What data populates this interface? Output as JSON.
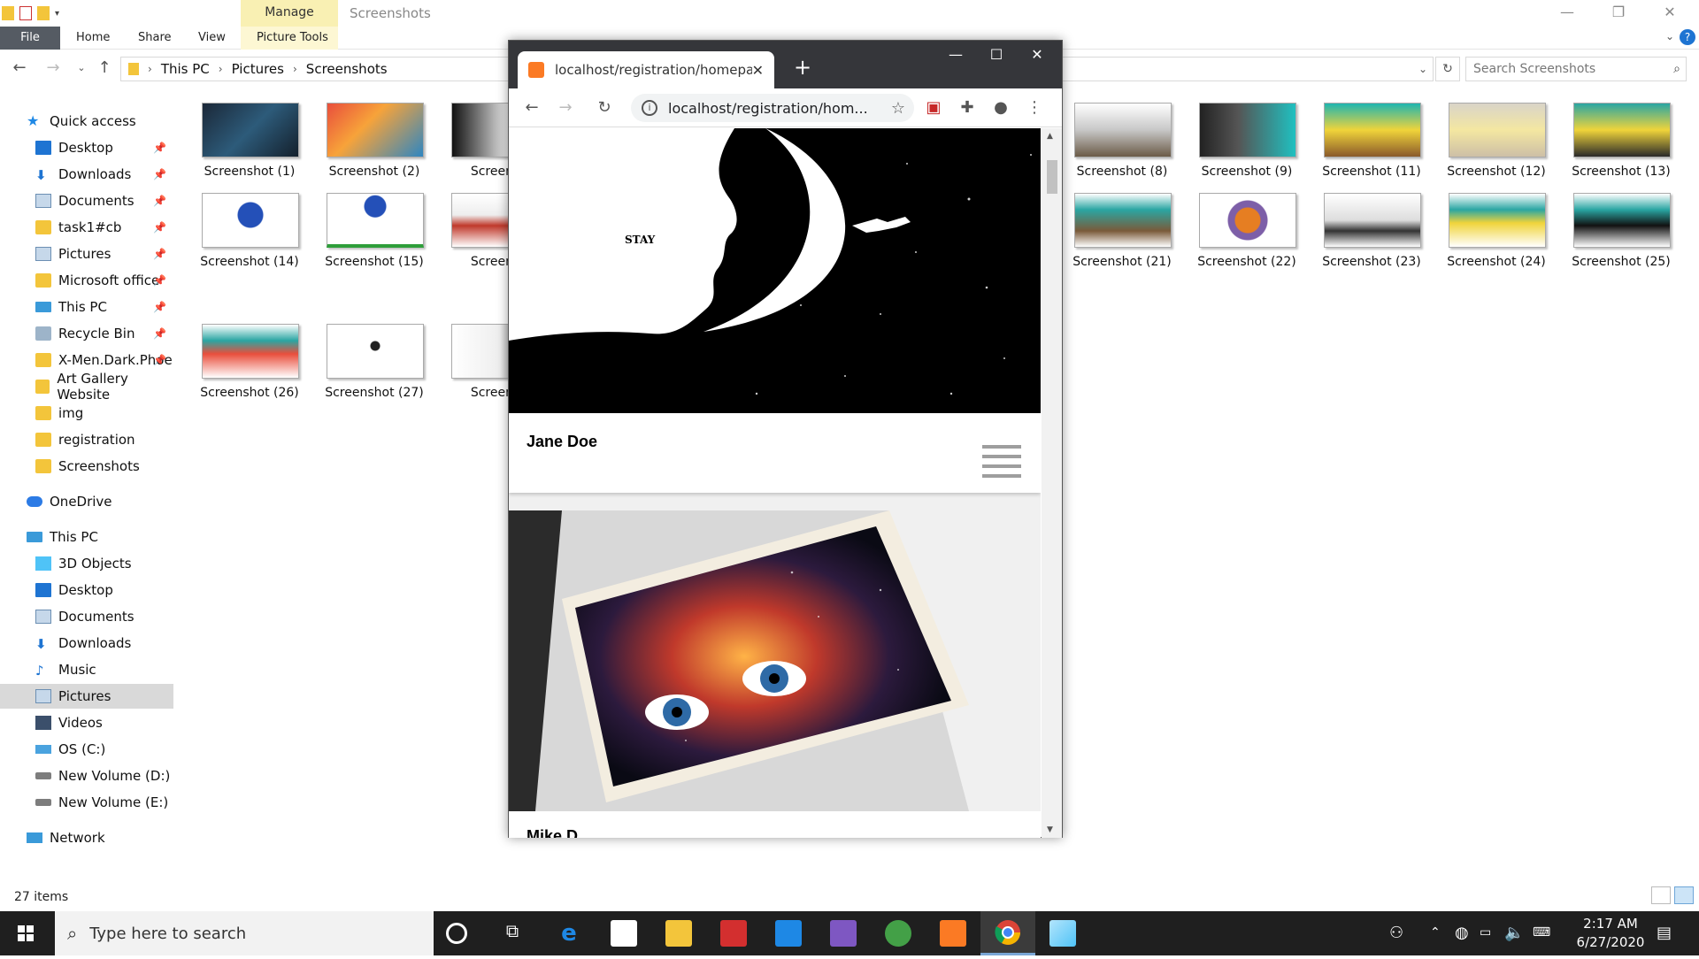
{
  "explorer": {
    "ribbon": {
      "manage": "Manage",
      "window_title": "Screenshots",
      "tabs": [
        "File",
        "Home",
        "Share",
        "View",
        "Picture Tools"
      ]
    },
    "address": {
      "crumbs": [
        "This PC",
        "Pictures",
        "Screenshots"
      ],
      "search_placeholder": "Search Screenshots"
    },
    "nav": {
      "quick_access": "Quick access",
      "quick_items": [
        "Desktop",
        "Downloads",
        "Documents",
        "task1#cb",
        "Pictures",
        "Microsoft office",
        "This PC",
        "Recycle Bin",
        "X-Men.Dark.Phoe",
        "Art Gallery Website",
        "img",
        "registration",
        "Screenshots"
      ],
      "onedrive": "OneDrive",
      "this_pc": "This PC",
      "pc_items": [
        "3D Objects",
        "Desktop",
        "Documents",
        "Downloads",
        "Music",
        "Pictures",
        "Videos",
        "OS (C:)",
        "New Volume (D:)",
        "New Volume (E:)"
      ],
      "network": "Network"
    },
    "thumbnails": [
      "Screenshot (1)",
      "Screenshot (2)",
      "Screensh",
      "Screenshot (8)",
      "Screenshot (9)",
      "Screenshot (11)",
      "Screenshot (12)",
      "Screenshot (13)",
      "Screenshot (14)",
      "Screenshot (15)",
      "Screensh",
      "Screenshot (21)",
      "Screenshot (22)",
      "Screenshot (23)",
      "Screenshot (24)",
      "Screenshot (25)",
      "Screenshot (26)",
      "Screenshot (27)",
      "Screensh"
    ],
    "status": "27 items"
  },
  "chrome": {
    "tab_title": "localhost/registration/homepage",
    "url": "localhost/registration/hom...",
    "cards": [
      {
        "name": "Jane Doe",
        "art_text": "STAY"
      },
      {
        "name": "Mike D"
      }
    ]
  },
  "taskbar": {
    "search_placeholder": "Type here to search",
    "time": "2:17 AM",
    "date": "6/27/2020"
  },
  "colors": {
    "manage_tab": "#f9f0b3",
    "chrome_titlebar": "#35363a",
    "taskbar": "#1f1f1f",
    "selected_nav": "#d9d9d9"
  }
}
